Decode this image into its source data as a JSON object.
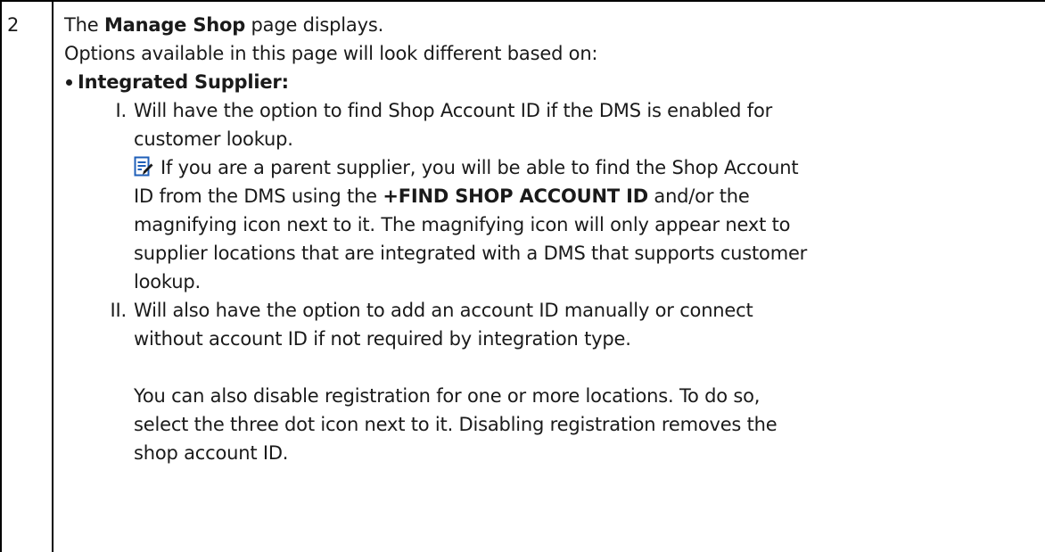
{
  "step_number": "2",
  "line1_prefix": "The ",
  "line1_bold": "Manage Shop",
  "line1_suffix": " page displays.",
  "line2": "Options available in this page will look different based on:",
  "bullet_label": "Integrated Supplier:",
  "items": [
    {
      "marker": "I.",
      "line1": "Will have the option to find Shop Account ID if the DMS is enabled for",
      "line2": "customer lookup."
    },
    {
      "marker": "II.",
      "line1": "Will also have the option to add an account ID manually or connect",
      "line2": "without account ID if not required by integration type."
    }
  ],
  "note": {
    "icon": "note-edit-icon",
    "line1": "If you are a parent supplier, you will be able to find the Shop Account",
    "line2_prefix": "ID from the DMS using the ",
    "line2_bold": "+FIND SHOP ACCOUNT ID",
    "line2_suffix": " and/or the",
    "line3": "magnifying icon next to it.  The magnifying icon will only appear next to",
    "line4": "supplier locations that are integrated with a DMS that supports customer",
    "line5": "lookup."
  },
  "footer": {
    "line1": "You can also disable registration for one or more locations. To do so,",
    "line2": "select the three dot icon next to it. Disabling registration removes the",
    "line3": "shop account ID."
  },
  "colors": {
    "text": "#1a1a1a",
    "border": "#000000",
    "icon_blue": "#1f5fb8"
  }
}
